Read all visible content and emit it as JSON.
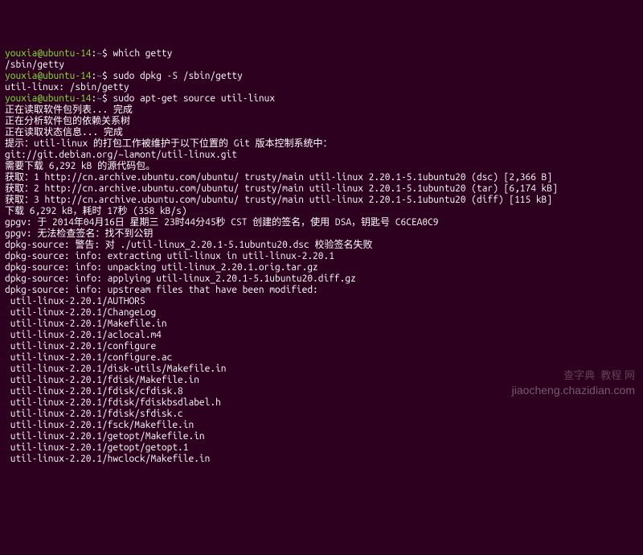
{
  "prompt": {
    "user": "youxia@ubuntu-14",
    "sep1": ":",
    "path": "~",
    "sep2": "$"
  },
  "commands": {
    "c1": "which getty",
    "c2": "sudo dpkg -S /sbin/getty",
    "c3": "sudo apt-get source util-linux"
  },
  "outputs": {
    "o1": "/sbin/getty",
    "o2": "util-linux: /sbin/getty",
    "o3": "正在读取软件包列表... 完成",
    "o4": "正在分析软件包的依赖关系树",
    "o5": "正在读取状态信息... 完成",
    "o6": "提示：util-linux 的打包工作被维护于以下位置的 Git 版本控制系统中：",
    "o7": "git://git.debian.org/~lamont/util-linux.git",
    "o8": "需要下载 6,292 kB 的源代码包。",
    "o9": "获取：1 http://cn.archive.ubuntu.com/ubuntu/ trusty/main util-linux 2.20.1-5.1ubuntu20 (dsc) [2,366 B]",
    "o10": "获取：2 http://cn.archive.ubuntu.com/ubuntu/ trusty/main util-linux 2.20.1-5.1ubuntu20 (tar) [6,174 kB]",
    "o11": "获取：3 http://cn.archive.ubuntu.com/ubuntu/ trusty/main util-linux 2.20.1-5.1ubuntu20 (diff) [115 kB]",
    "o12": "下载 6,292 kB，耗时 17秒 (358 kB/s)",
    "o13": "gpgv: 于 2014年04月16日 星期三 23时44分45秒 CST 创建的签名，使用 DSA，钥匙号 C6CEA0C9",
    "o14": "gpgv: 无法检查签名：找不到公钥",
    "o15": "dpkg-source: 警告: 对 ./util-linux_2.20.1-5.1ubuntu20.dsc 校验签名失败",
    "o16": "dpkg-source: info: extracting util-linux in util-linux-2.20.1",
    "o17": "dpkg-source: info: unpacking util-linux_2.20.1.orig.tar.gz",
    "o18": "dpkg-source: info: applying util-linux_2.20.1-5.1ubuntu20.diff.gz",
    "o19": "dpkg-source: info: upstream files that have been modified:"
  },
  "files": [
    " util-linux-2.20.1/AUTHORS",
    " util-linux-2.20.1/ChangeLog",
    " util-linux-2.20.1/Makefile.in",
    " util-linux-2.20.1/aclocal.m4",
    " util-linux-2.20.1/configure",
    " util-linux-2.20.1/configure.ac",
    " util-linux-2.20.1/disk-utils/Makefile.in",
    " util-linux-2.20.1/fdisk/Makefile.in",
    " util-linux-2.20.1/fdisk/cfdisk.8",
    " util-linux-2.20.1/fdisk/fdiskbsdlabel.h",
    " util-linux-2.20.1/fdisk/sfdisk.c",
    " util-linux-2.20.1/fsck/Makefile.in",
    " util-linux-2.20.1/getopt/Makefile.in",
    " util-linux-2.20.1/getopt/getopt.1",
    " util-linux-2.20.1/hwclock/Makefile.in"
  ],
  "watermark": {
    "w1": "查字典  教程 网",
    "w2": "jiaocheng.chazidian.com"
  }
}
